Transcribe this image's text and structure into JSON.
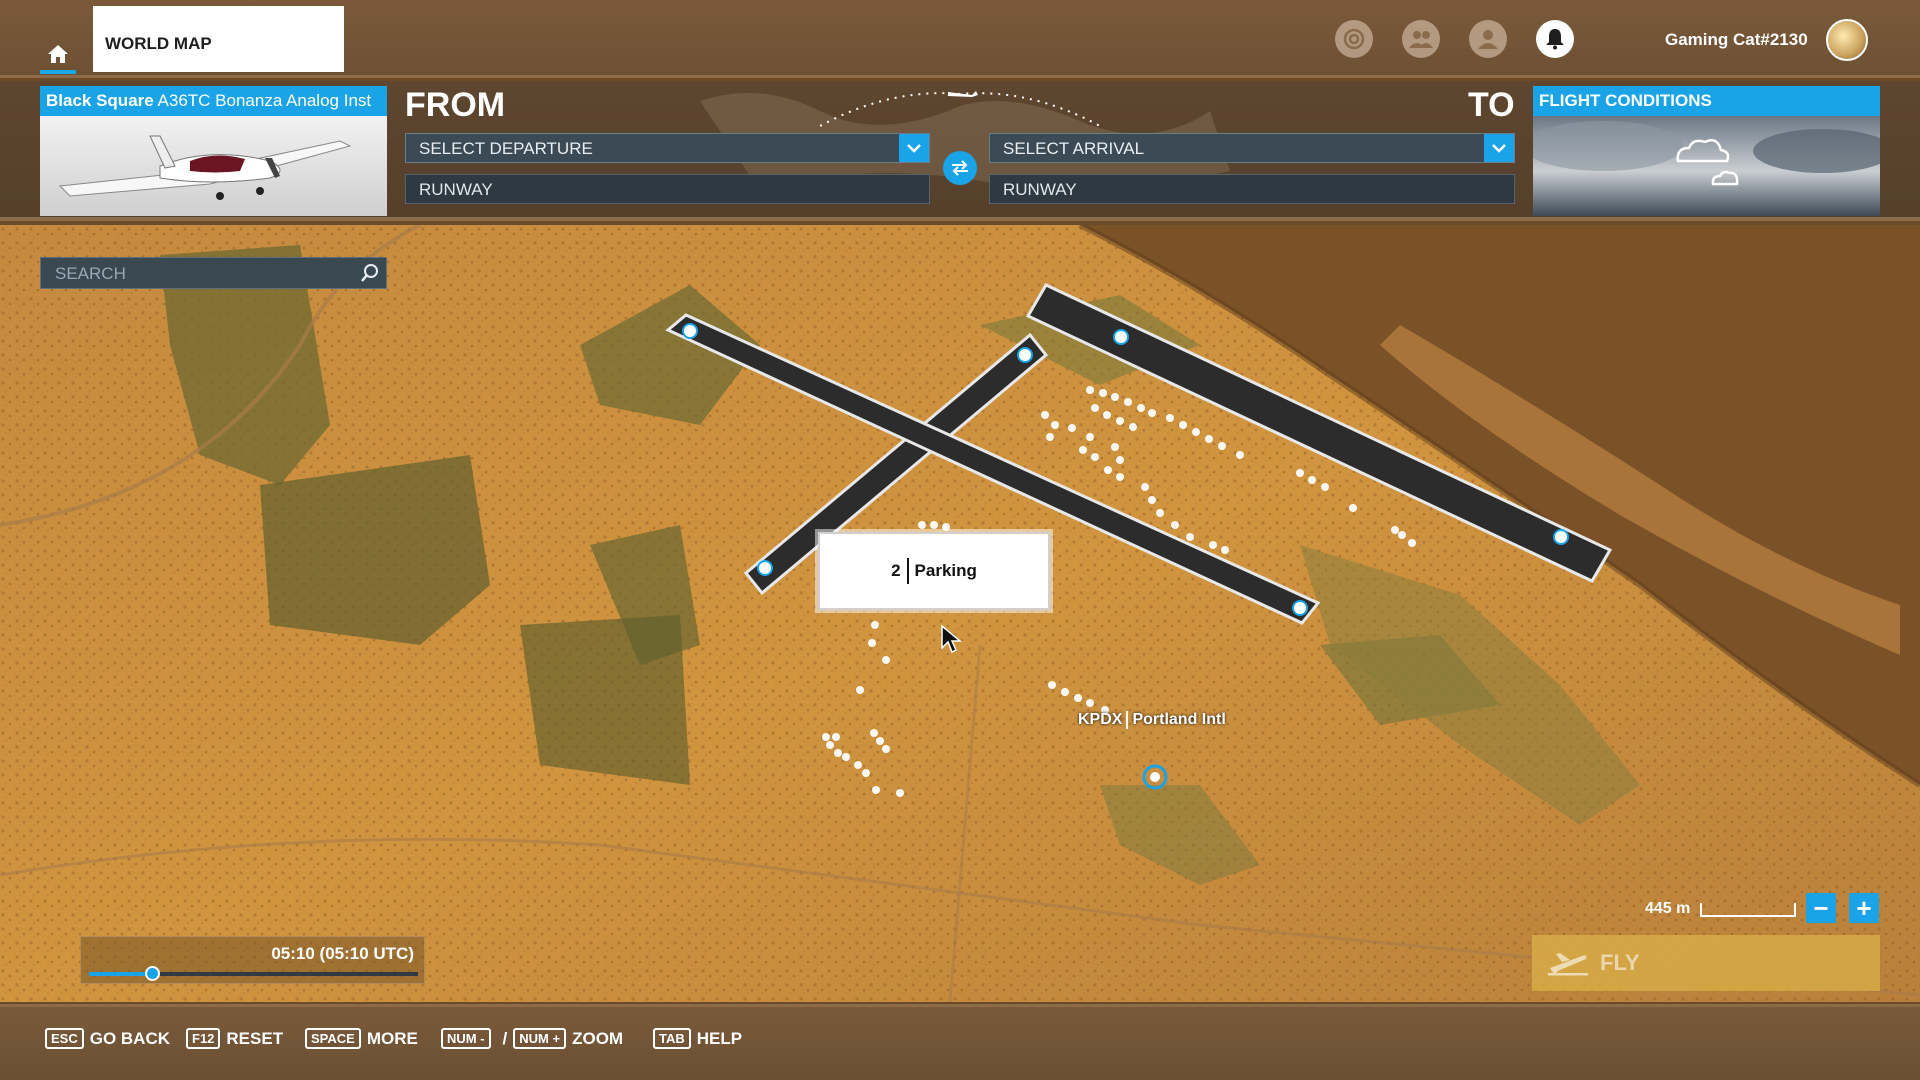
{
  "topbar": {
    "tab_label": "WORLD MAP",
    "username": "Gaming Cat#2130",
    "icons": [
      "home-icon",
      "achievements-icon",
      "friends-icon",
      "profile-icon",
      "notifications-icon"
    ]
  },
  "planner": {
    "aircraft": {
      "brand": "Black Square",
      "model": "A36TC Bonanza Analog Inst"
    },
    "from_label": "FROM",
    "to_label": "TO",
    "departure_placeholder": "SELECT DEPARTURE",
    "arrival_placeholder": "SELECT ARRIVAL",
    "departure_runway": "RUNWAY",
    "arrival_runway": "RUNWAY",
    "conditions_title": "FLIGHT CONDITIONS"
  },
  "map": {
    "search_placeholder": "SEARCH",
    "popup_number": "2",
    "popup_label": "Parking",
    "airport_code": "KPDX",
    "airport_name": "Portland Intl",
    "scale_label": "445 m"
  },
  "time": {
    "display": "05:10 (05:10 UTC)",
    "progress": 0.19
  },
  "fly_label": "FLY",
  "hints": [
    {
      "key": "ESC",
      "label": "GO BACK"
    },
    {
      "key": "F12",
      "label": "RESET"
    },
    {
      "key": "SPACE",
      "label": "MORE"
    },
    {
      "key": "NUM -",
      "key2": "NUM +",
      "label": "ZOOM"
    },
    {
      "key": "TAB",
      "label": "HELP"
    }
  ],
  "colors": {
    "accent": "#1aa3e6",
    "fly": "#d7aa46"
  }
}
